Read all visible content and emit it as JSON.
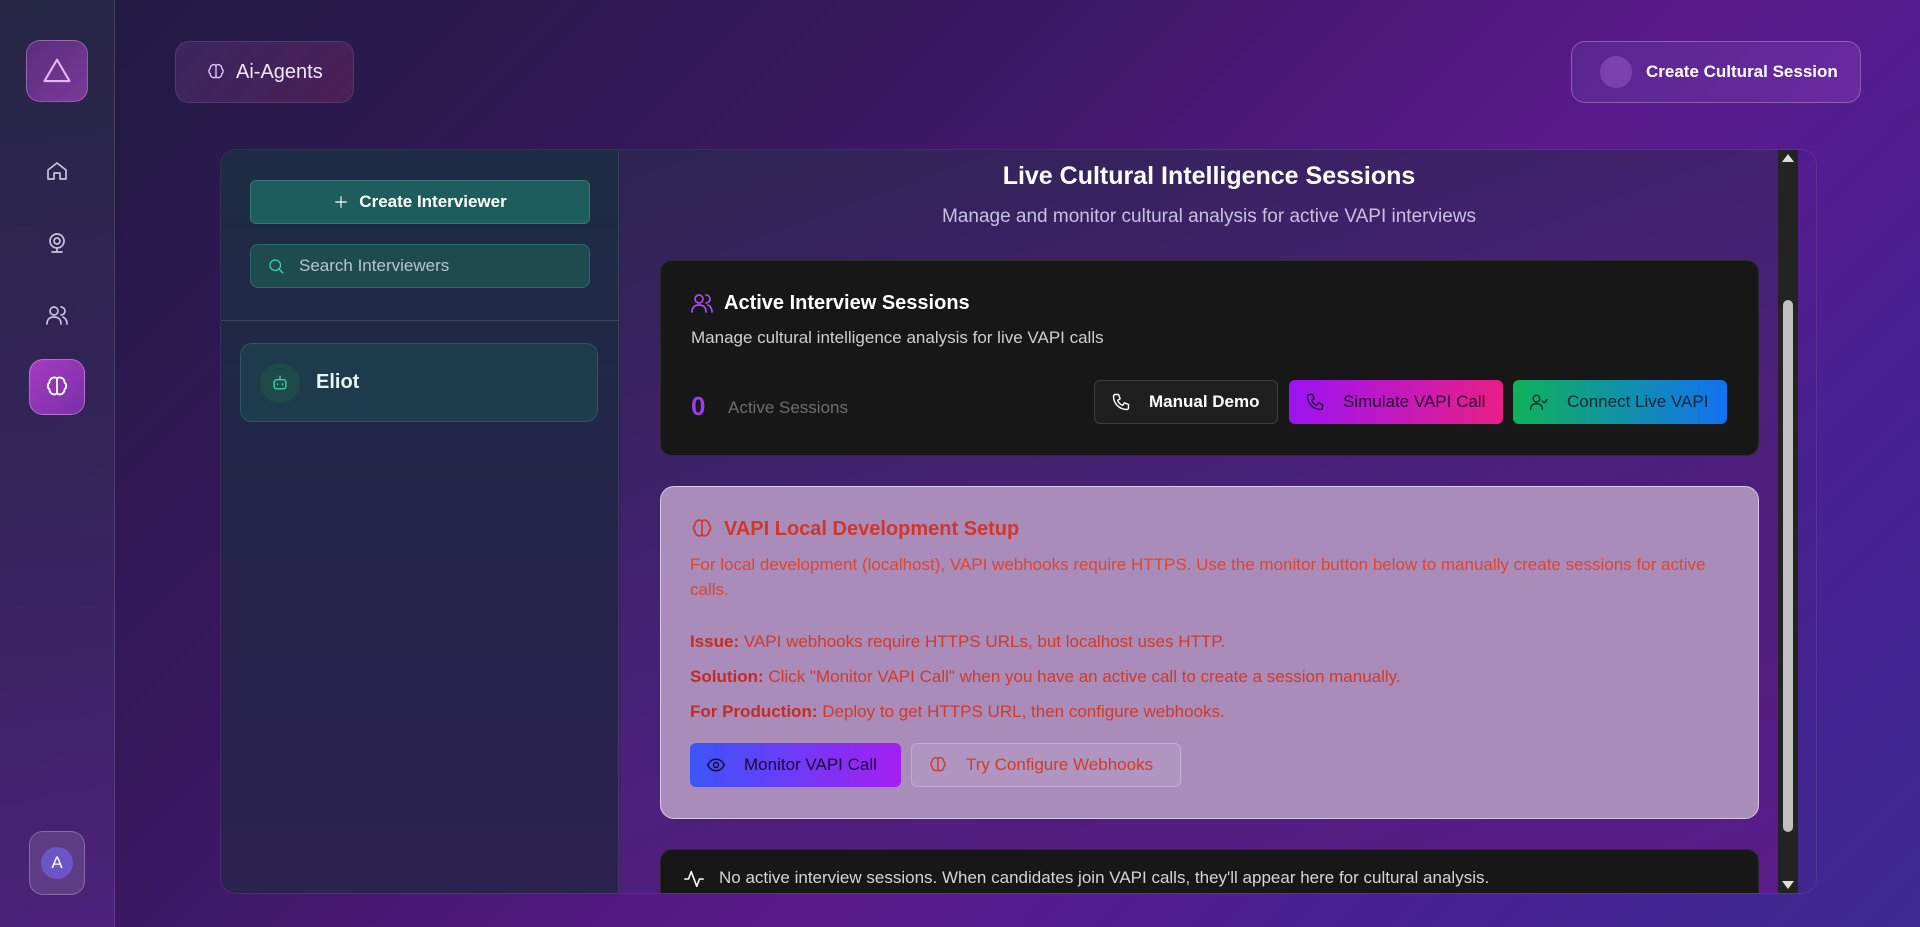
{
  "app": {
    "agents_chip_label": "Ai-Agents",
    "create_session_label": "Create Cultural Session",
    "avatar_initial": "A"
  },
  "sidebar": {
    "items": [
      {
        "icon": "home-icon"
      },
      {
        "icon": "webcam-icon"
      },
      {
        "icon": "users-icon"
      },
      {
        "icon": "brain-icon",
        "active": true
      }
    ]
  },
  "interviewers": {
    "create_label": "Create Interviewer",
    "search_placeholder": "Search Interviewers",
    "items": [
      {
        "name": "Eliot"
      }
    ]
  },
  "main": {
    "title": "Live Cultural Intelligence Sessions",
    "subtitle": "Manage and monitor cultural analysis for active VAPI interviews",
    "sessions_card": {
      "title": "Active Interview Sessions",
      "description": "Manage cultural intelligence analysis for live VAPI calls",
      "count": "0",
      "count_label": "Active Sessions",
      "manual_demo_label": "Manual Demo",
      "simulate_label": "Simulate VAPI Call",
      "connect_label": "Connect Live VAPI"
    },
    "setup_card": {
      "title": "VAPI Local Development Setup",
      "description": "For local development (localhost), VAPI webhooks require HTTPS. Use the monitor button below to manually create sessions for active calls.",
      "issue_label": "Issue:",
      "issue_text": "VAPI webhooks require HTTPS URLs, but localhost uses HTTP.",
      "solution_label": "Solution:",
      "solution_text": "Click \"Monitor VAPI Call\" when you have an active call to create a session manually.",
      "production_label": "For Production:",
      "production_text": "Deploy to get HTTPS URL, then configure webhooks.",
      "monitor_label": "Monitor VAPI Call",
      "webhooks_label": "Try Configure Webhooks"
    },
    "empty_message": "No active interview sessions. When candidates join VAPI calls, they'll appear here for cultural analysis."
  },
  "colors": {
    "accent_purple": "#9b3cf0",
    "teal": "#1e5d5e",
    "warning_red": "#d1362b"
  }
}
